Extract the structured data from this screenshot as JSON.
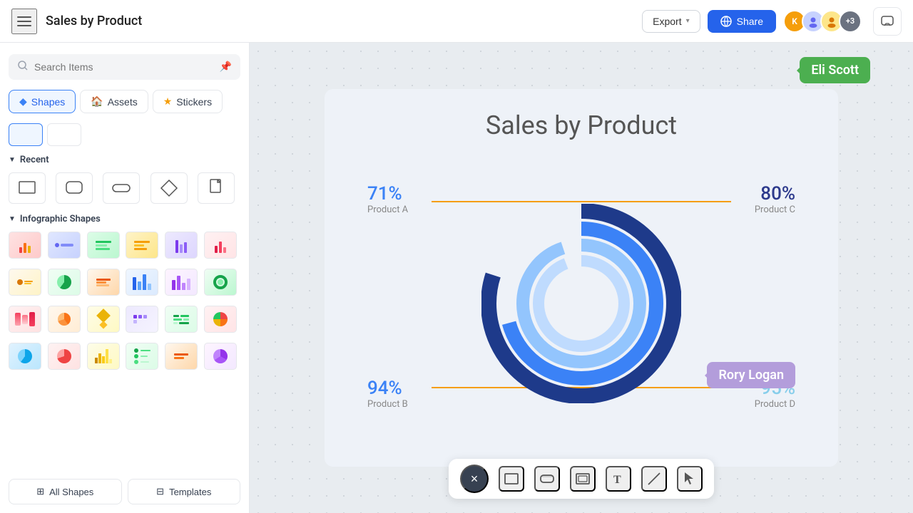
{
  "header": {
    "menu_label": "Menu",
    "title": "Sales by Product",
    "export_label": "Export",
    "share_label": "Share",
    "avatar_k": "K",
    "avatar_count": "+3"
  },
  "sidebar": {
    "search_placeholder": "Search Items",
    "tabs": [
      {
        "id": "shapes",
        "label": "Shapes",
        "icon": "◆",
        "active": true
      },
      {
        "id": "assets",
        "label": "Assets",
        "icon": "🏠",
        "active": false
      },
      {
        "id": "stickers",
        "label": "Stickers",
        "icon": "★",
        "active": false
      }
    ],
    "recent_section": "Recent",
    "infographic_section": "Infographic Shapes",
    "bottom_buttons": [
      {
        "id": "all-shapes",
        "label": "All Shapes",
        "icon": "⊞"
      },
      {
        "id": "templates",
        "label": "Templates",
        "icon": "⊟"
      }
    ]
  },
  "chart": {
    "title": "Sales by Product",
    "products": [
      {
        "id": "a",
        "label": "Product A",
        "value": "71%",
        "position": "top-left"
      },
      {
        "id": "b",
        "label": "Product B",
        "value": "94%",
        "position": "bottom-left"
      },
      {
        "id": "c",
        "label": "Product C",
        "value": "80%",
        "position": "top-right"
      },
      {
        "id": "d",
        "label": "Product D",
        "value": "95%",
        "position": "bottom-right"
      }
    ]
  },
  "tooltips": [
    {
      "id": "eli",
      "name": "Eli Scott",
      "color": "#4caf50"
    },
    {
      "id": "rory",
      "name": "Rory Logan",
      "color": "#b39ddb"
    }
  ],
  "toolbar": {
    "close_label": "×",
    "tools": [
      {
        "id": "rectangle",
        "icon": "□"
      },
      {
        "id": "rounded-rect",
        "icon": "▭"
      },
      {
        "id": "frame",
        "icon": "◱"
      },
      {
        "id": "text",
        "icon": "T"
      },
      {
        "id": "line",
        "icon": "/"
      },
      {
        "id": "pointer",
        "icon": "⌖"
      }
    ]
  }
}
